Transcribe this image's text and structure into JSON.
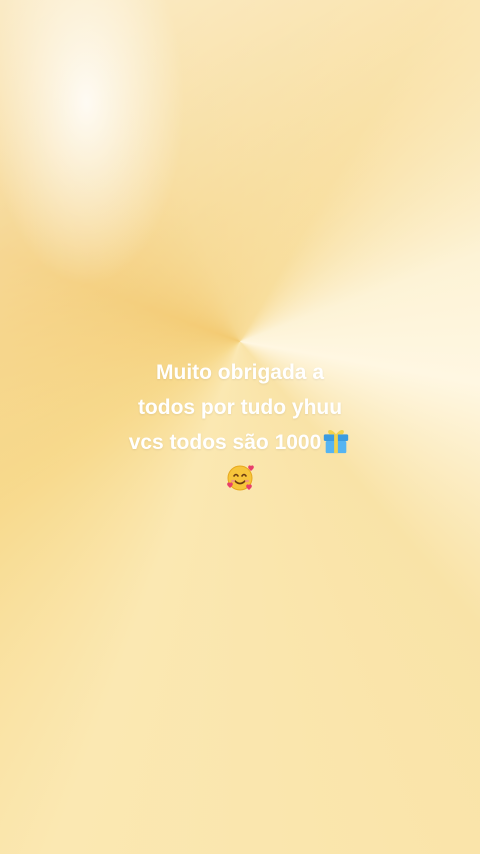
{
  "caption": {
    "line1": "Muito obrigada a",
    "line2": "todos por tudo yhuu",
    "line3": "vcs todos são 1000",
    "line3_icon": "gift-icon",
    "line4_icon": "smiling-face-with-hearts-icon"
  },
  "colors": {
    "text": "#ffffff",
    "background_main": "#f6d88e",
    "background_highlight": "#fff7e2"
  }
}
